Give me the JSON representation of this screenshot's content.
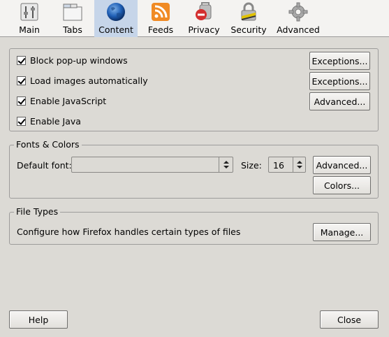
{
  "toolbar": {
    "tabs": [
      {
        "label": "Main",
        "icon": "switch-icon"
      },
      {
        "label": "Tabs",
        "icon": "tabs-icon"
      },
      {
        "label": "Content",
        "icon": "globe-icon"
      },
      {
        "label": "Feeds",
        "icon": "rss-feed-icon"
      },
      {
        "label": "Privacy",
        "icon": "no-entry-icon"
      },
      {
        "label": "Security",
        "icon": "padlock-icon"
      },
      {
        "label": "Advanced",
        "icon": "gear-icon"
      }
    ],
    "selected_tab": "Content",
    "selected_color": "#c6d5e9"
  },
  "content": {
    "block_popups": {
      "label": "Block pop-up windows",
      "checked": true,
      "button": "Exceptions..."
    },
    "load_images": {
      "label": "Load images automatically",
      "checked": true,
      "button": "Exceptions..."
    },
    "enable_js": {
      "label": "Enable JavaScript",
      "checked": true,
      "button": "Advanced..."
    },
    "enable_java": {
      "label": "Enable Java",
      "checked": true
    }
  },
  "fonts": {
    "legend": "Fonts & Colors",
    "default_font_label": "Default font:",
    "default_font_value": "",
    "size_label": "Size:",
    "size_value": "16",
    "advanced_button": "Advanced...",
    "colors_button": "Colors..."
  },
  "file_types": {
    "legend": "File Types",
    "description": "Configure how Firefox handles certain types of files",
    "manage_button": "Manage..."
  },
  "footer": {
    "help_button": "Help",
    "close_button": "Close"
  }
}
